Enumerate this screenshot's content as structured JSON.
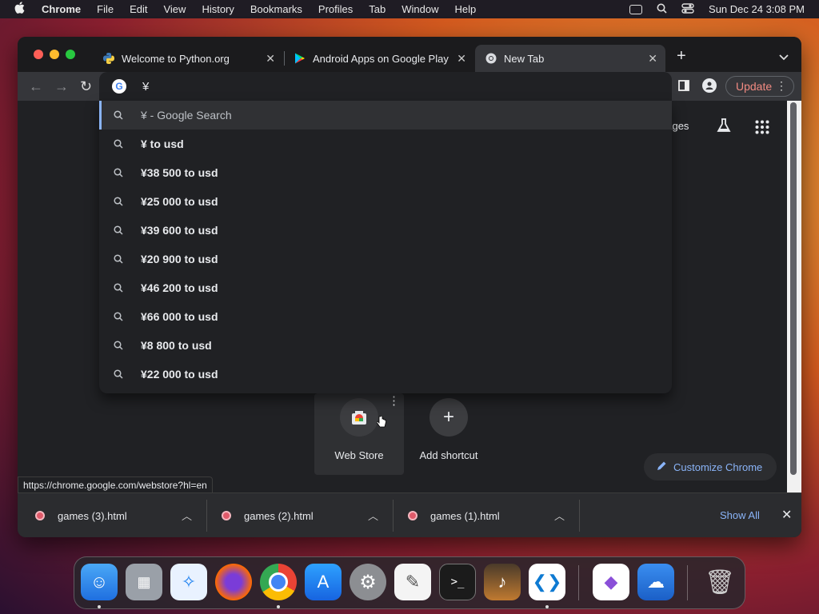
{
  "menubar": {
    "app": "Chrome",
    "items": [
      "File",
      "Edit",
      "View",
      "History",
      "Bookmarks",
      "Profiles",
      "Tab",
      "Window",
      "Help"
    ],
    "datetime": "Sun Dec 24  3:08 PM"
  },
  "tabs": [
    {
      "title": "Welcome to Python.org",
      "icon": "python-icon"
    },
    {
      "title": "Android Apps on Google Play",
      "icon": "google-play-icon"
    },
    {
      "title": "New Tab",
      "icon": "chrome-icon",
      "active": true
    }
  ],
  "omnibox": {
    "value": "¥"
  },
  "toolbar": {
    "update_label": "Update"
  },
  "suggestions": [
    "¥ - Google Search",
    "¥ to usd",
    "¥38 500 to usd",
    "¥25 000 to usd",
    "¥39 600 to usd",
    "¥20 900 to usd",
    "¥46 200 to usd",
    "¥66 000 to usd",
    "¥8 800 to usd",
    "¥22 000 to usd"
  ],
  "ntp": {
    "images_link": "nages",
    "shortcuts": [
      {
        "label": "Web Store",
        "icon": "web-store-icon"
      },
      {
        "label": "Add shortcut",
        "icon": "plus-icon"
      }
    ],
    "customize_label": "Customize Chrome"
  },
  "status_url": "https://chrome.google.com/webstore?hl=en",
  "downloads": {
    "items": [
      "games (3).html",
      "games (2).html",
      "games (1).html"
    ],
    "show_all": "Show All"
  },
  "colors": {
    "accent": "#8ab4f8",
    "update": "#f28b82",
    "window_bg": "#202124"
  },
  "dock": [
    "finder",
    "launchpad",
    "safari",
    "firefox",
    "chrome",
    "app-store",
    "system-settings",
    "textedit",
    "terminal",
    "garageband",
    "vscode",
    "visual-studio",
    "weather",
    "trash"
  ]
}
